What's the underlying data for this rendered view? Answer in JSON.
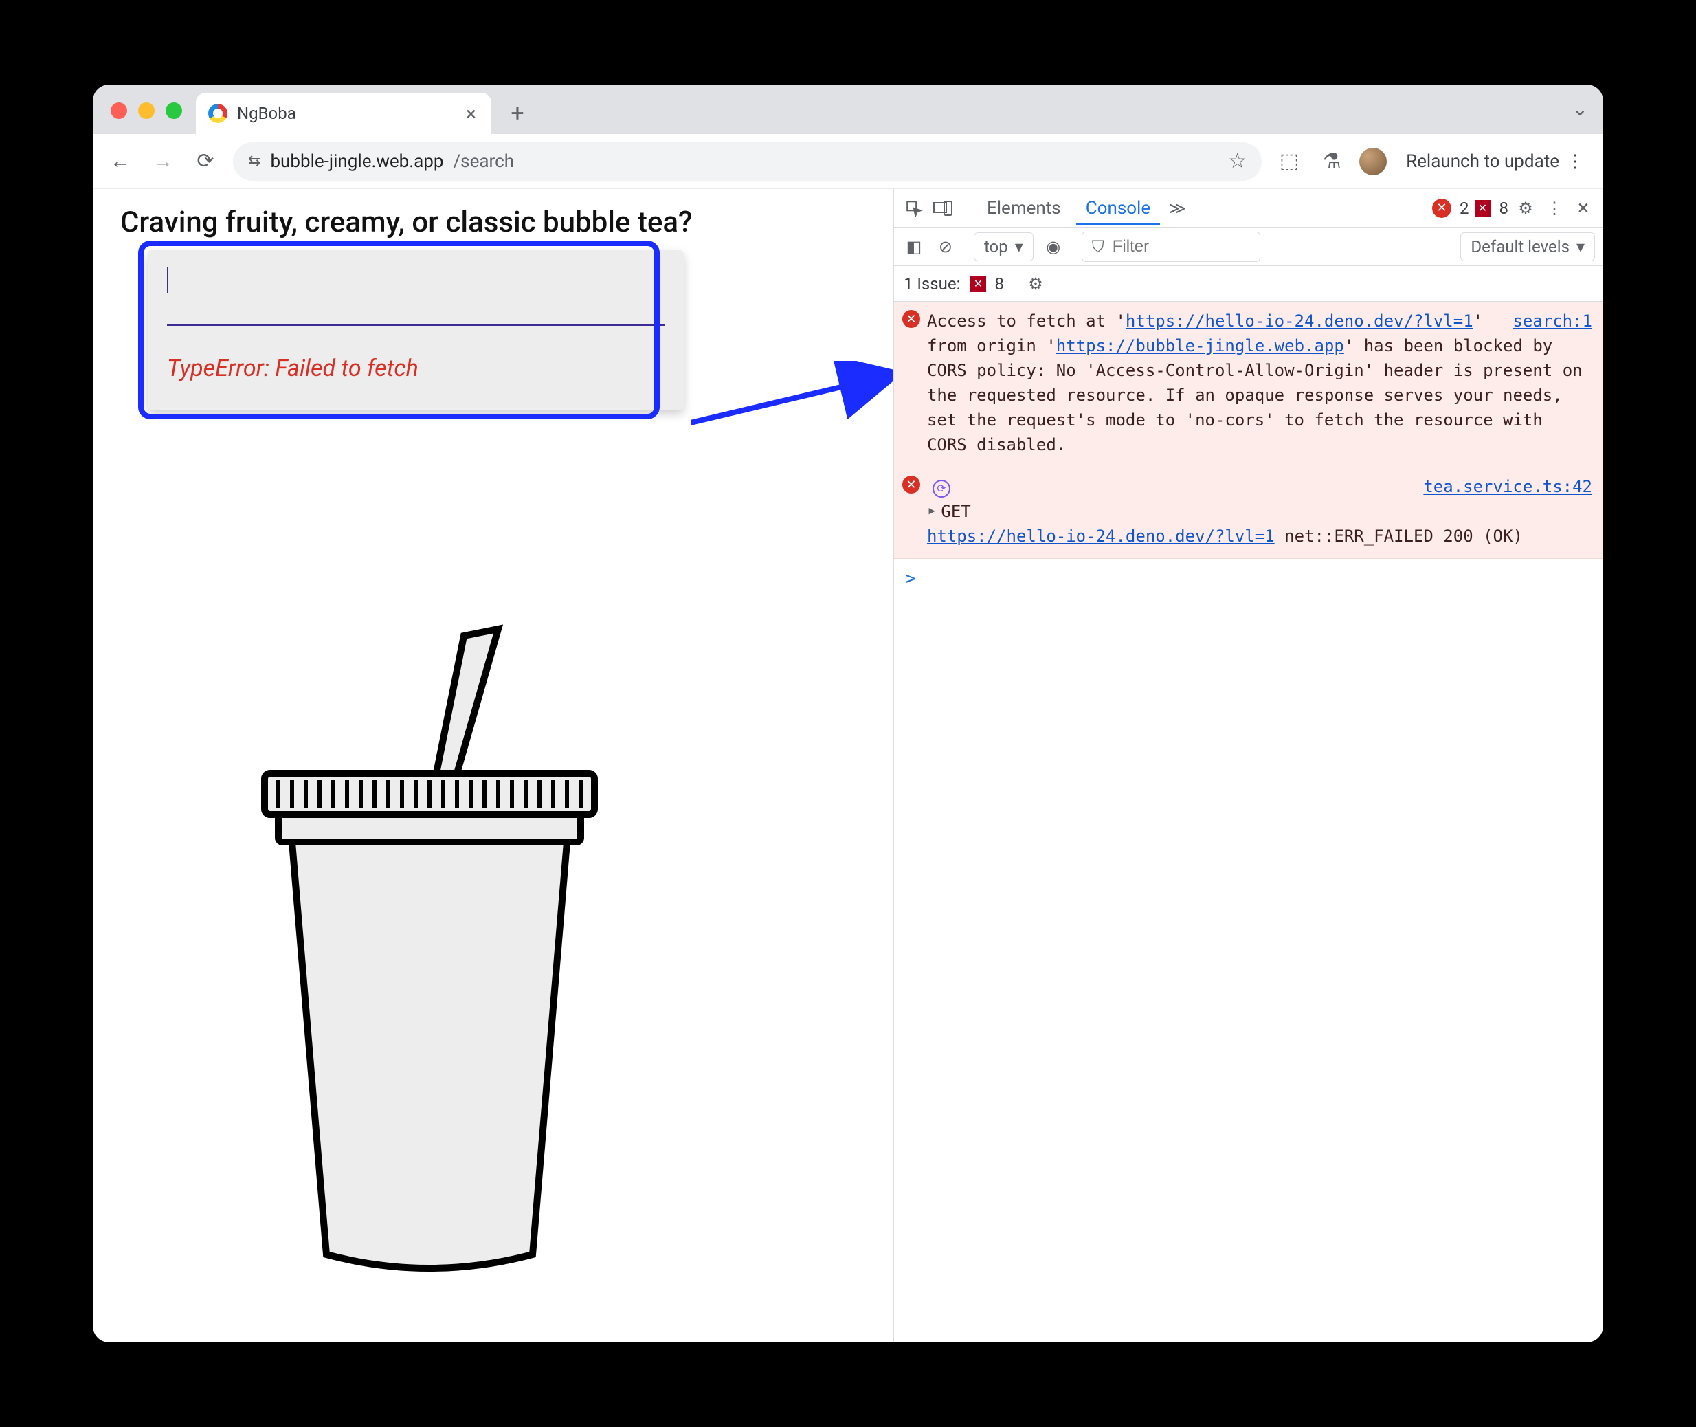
{
  "browser": {
    "tab_title": "NgBoba",
    "url_host": "bubble-jingle.web.app",
    "url_path": "/search",
    "relaunch": "Relaunch to update"
  },
  "page": {
    "heading": "Craving fruity, creamy, or classic bubble tea?",
    "search_value": "",
    "error": "TypeError: Failed to fetch"
  },
  "devtools": {
    "tabs": {
      "elements": "Elements",
      "console": "Console"
    },
    "error_count": "2",
    "warn_count": "8",
    "context": "top",
    "filter_placeholder": "Filter",
    "levels": "Default levels",
    "issues_label": "1 Issue:",
    "issues_count": "8"
  },
  "console": {
    "msg1": {
      "source": "search:1",
      "pre": "Access to fetch at '",
      "url1": "https://hello-io-24.deno.dev/?lvl=1",
      "mid": "' from origin '",
      "url2": "https://bubble-jingle.web.app",
      "post": "' has been blocked by CORS policy: No 'Access-Control-Allow-Origin' header is present on the requested resource. If an opaque response serves your needs, set the request's mode to 'no-cors' to fetch the resource with CORS disabled."
    },
    "msg2": {
      "source": "tea.service.ts:42",
      "method": "GET",
      "url": "https://hello-io-24.deno.dev/?lvl=1",
      "tail": " net::ERR_FAILED 200 (OK)"
    },
    "prompt": ">"
  }
}
